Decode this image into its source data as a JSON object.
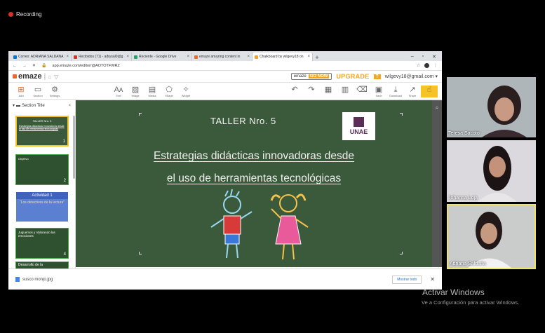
{
  "meeting": {
    "recording_label": "Recording"
  },
  "browser": {
    "tabs": [
      {
        "label": "Correo: ADRIANA SALDAÑA C",
        "color": "#0078d4"
      },
      {
        "label": "Recibidos (71) - adrysal0@g",
        "color": "#d93025"
      },
      {
        "label": "Reciente - Google Drive",
        "color": "#1fa463"
      },
      {
        "label": "emaze amazing content in",
        "color": "#e96a2b"
      },
      {
        "label": "Chalkboard by wilgevy18 on",
        "color": "#f6a31e"
      }
    ],
    "url": "app.emaze.com/editor/@AOTOTFWRZ"
  },
  "emaze": {
    "logo": "emaze",
    "promo_brand": "emaze",
    "promo_go": "GO NOW",
    "upgrade": "UPGRADE",
    "help": "?",
    "account": "wilgevy18@gmail.com ▾",
    "left_tools": [
      {
        "icon": "add-icon",
        "glyph": "+",
        "label": "Add"
      },
      {
        "icon": "section-icon",
        "glyph": "▭",
        "label": "Section"
      },
      {
        "icon": "settings-icon",
        "glyph": "⚙",
        "label": "Settings"
      }
    ],
    "mid_tools": [
      {
        "icon": "text-icon",
        "glyph": "Aᴀ",
        "label": "Text"
      },
      {
        "icon": "image-icon",
        "glyph": "▨",
        "label": "Image"
      },
      {
        "icon": "media-icon",
        "glyph": "▤",
        "label": "Media"
      },
      {
        "icon": "shape-icon",
        "glyph": "⬠",
        "label": "Shape"
      },
      {
        "icon": "widget-icon",
        "glyph": "✧",
        "label": "Widget"
      }
    ],
    "right_tools": [
      {
        "icon": "undo-icon",
        "glyph": "↶",
        "label": ""
      },
      {
        "icon": "redo-icon",
        "glyph": "↷",
        "label": ""
      },
      {
        "icon": "copy-icon",
        "glyph": "▦",
        "label": ""
      },
      {
        "icon": "paste-icon",
        "glyph": "▥",
        "label": ""
      },
      {
        "icon": "trash-icon",
        "glyph": "🗑",
        "label": ""
      },
      {
        "icon": "save-icon",
        "glyph": "▣",
        "label": "Save"
      },
      {
        "icon": "download-icon",
        "glyph": "⤓",
        "label": "Download"
      },
      {
        "icon": "share-icon",
        "glyph": "↗",
        "label": "Share"
      }
    ]
  },
  "sidebar": {
    "section_title": "Section Title",
    "thumbs": [
      {
        "title": "TALLER Nro. 5",
        "text": "Estrategias didácticas innovadoras desde el uso de herramientas tecnológicas",
        "num": "1"
      },
      {
        "title": "Objetivo",
        "text": "",
        "num": "2"
      },
      {
        "title": "Actividad 1",
        "text": "\"Los detectives de la lectura\"",
        "num": ""
      },
      {
        "title": "Juguemos y Valorando las emociones",
        "text": "",
        "num": "4"
      },
      {
        "title": "Desarrollo de la",
        "text": "",
        "num": ""
      }
    ]
  },
  "slide": {
    "title": "TALLER Nro. 5",
    "logo_text": "UNAE",
    "subtitle_line1": "Estrategias didácticas innovadoras desde",
    "subtitle_line2": "el uso de herramientas tecnológicas"
  },
  "downloads": {
    "file": "susco monjo.jpg",
    "show_all": "Mostrar todo"
  },
  "participants": [
    {
      "name": "Teresa Sacoto"
    },
    {
      "name": "Johanna Loja"
    },
    {
      "name": "Adriana Saldaña"
    }
  ],
  "os_watermark": {
    "line1": "Activar Windows",
    "line2": "Ve a Configuración para activar Windows."
  },
  "colors": {
    "chalkboard": "#3a5a3b",
    "emaze_orange": "#e96a2b",
    "upgrade_yellow": "#f6a31e",
    "unae_purple": "#5a2e57"
  }
}
